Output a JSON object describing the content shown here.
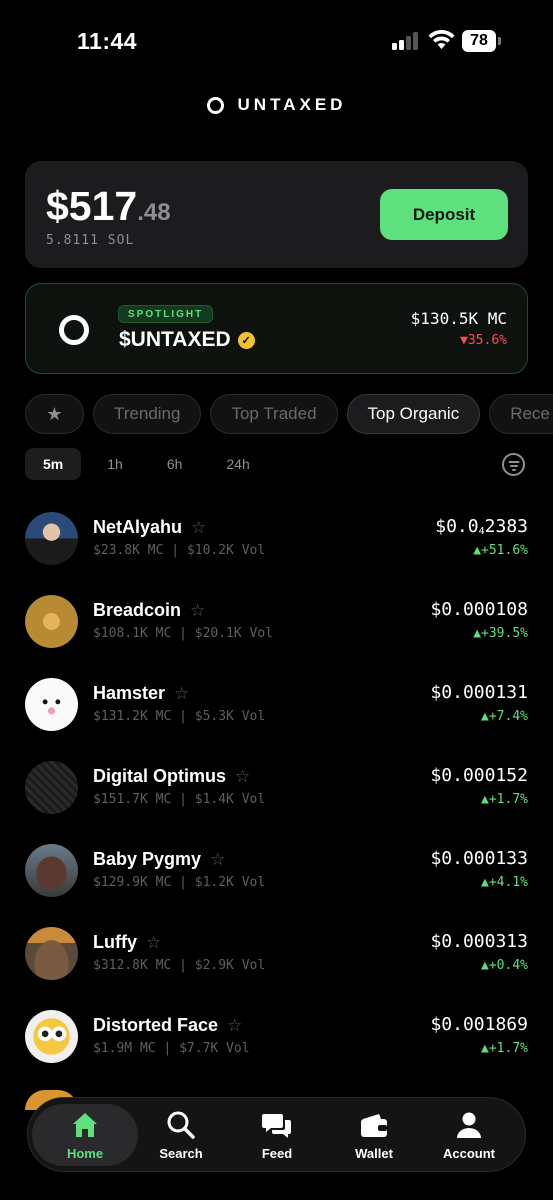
{
  "status_bar": {
    "time": "11:44",
    "battery": "78"
  },
  "header": {
    "brand": "UNTAXED"
  },
  "balance": {
    "amount": "$517",
    "cents": ".48",
    "sol": "5.8111 SOL",
    "deposit_label": "Deposit"
  },
  "spotlight": {
    "badge": "SPOTLIGHT",
    "name": "$UNTAXED",
    "market_cap": "$130.5K MC",
    "change": "▼35.6%"
  },
  "categories": [
    "Trending",
    "Top Traded",
    "Top Organic",
    "Rece"
  ],
  "active_category": "Top Organic",
  "time_tabs": [
    "5m",
    "1h",
    "6h",
    "24h"
  ],
  "active_time_tab": "5m",
  "tokens": [
    {
      "name": "NetAlyahu",
      "meta": "$23.8K MC | $10.2K Vol",
      "price_prefix": "$0.0",
      "price_sub": "4",
      "price_suffix": "2383",
      "change": "▲+51.6%"
    },
    {
      "name": "Breadcoin",
      "meta": "$108.1K MC | $20.1K Vol",
      "price_prefix": "$0.000108",
      "price_sub": "",
      "price_suffix": "",
      "change": "▲+39.5%"
    },
    {
      "name": "Hamster",
      "meta": "$131.2K MC | $5.3K Vol",
      "price_prefix": "$0.000131",
      "price_sub": "",
      "price_suffix": "",
      "change": "▲+7.4%"
    },
    {
      "name": "Digital Optimus",
      "meta": "$151.7K MC | $1.4K Vol",
      "price_prefix": "$0.000152",
      "price_sub": "",
      "price_suffix": "",
      "change": "▲+1.7%"
    },
    {
      "name": "Baby Pygmy",
      "meta": "$129.9K MC | $1.2K Vol",
      "price_prefix": "$0.000133",
      "price_sub": "",
      "price_suffix": "",
      "change": "▲+4.1%"
    },
    {
      "name": "Luffy",
      "meta": "$312.8K MC | $2.9K Vol",
      "price_prefix": "$0.000313",
      "price_sub": "",
      "price_suffix": "",
      "change": "▲+0.4%"
    },
    {
      "name": "Distorted Face",
      "meta": "$1.9M MC | $7.7K Vol",
      "price_prefix": "$0.001869",
      "price_sub": "",
      "price_suffix": "",
      "change": "▲+1.7%"
    }
  ],
  "nav": {
    "home": "Home",
    "search": "Search",
    "feed": "Feed",
    "wallet": "Wallet",
    "account": "Account"
  },
  "colors": {
    "accent_green": "#5fe07e",
    "negative_red": "#ff4d57",
    "background": "#000000",
    "card": "#1c1c1e"
  }
}
